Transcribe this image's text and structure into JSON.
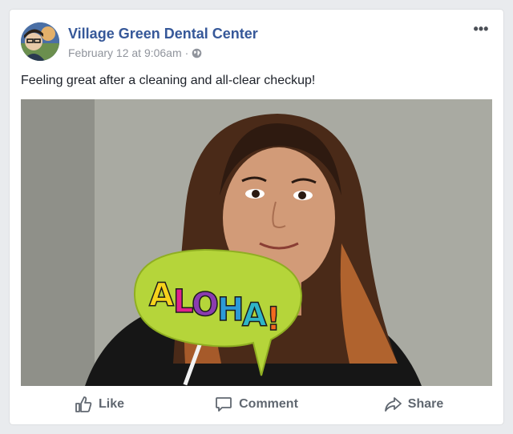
{
  "post": {
    "page_name": "Village Green Dental Center",
    "timestamp": "February 12 at 9:06am",
    "separator": "·",
    "privacy_icon": "globe-icon",
    "more_label": "•••",
    "text": "Feeling great after a cleaning and all-clear checkup!"
  },
  "photo": {
    "sign_text": "ALOHA!",
    "sign_letter_colors": [
      "#f6d21b",
      "#e0208c",
      "#8b3bb0",
      "#2c9ad8",
      "#2fb5c7",
      "#f26a1f"
    ],
    "sign_color": "#b5d53a"
  },
  "actions": [
    {
      "label": "Like",
      "icon": "thumbs-up-icon"
    },
    {
      "label": "Comment",
      "icon": "comment-icon"
    },
    {
      "label": "Share",
      "icon": "share-icon"
    }
  ],
  "colors": {
    "link": "#365899",
    "meta": "#90949c",
    "text": "#1d2129",
    "action": "#606770"
  }
}
